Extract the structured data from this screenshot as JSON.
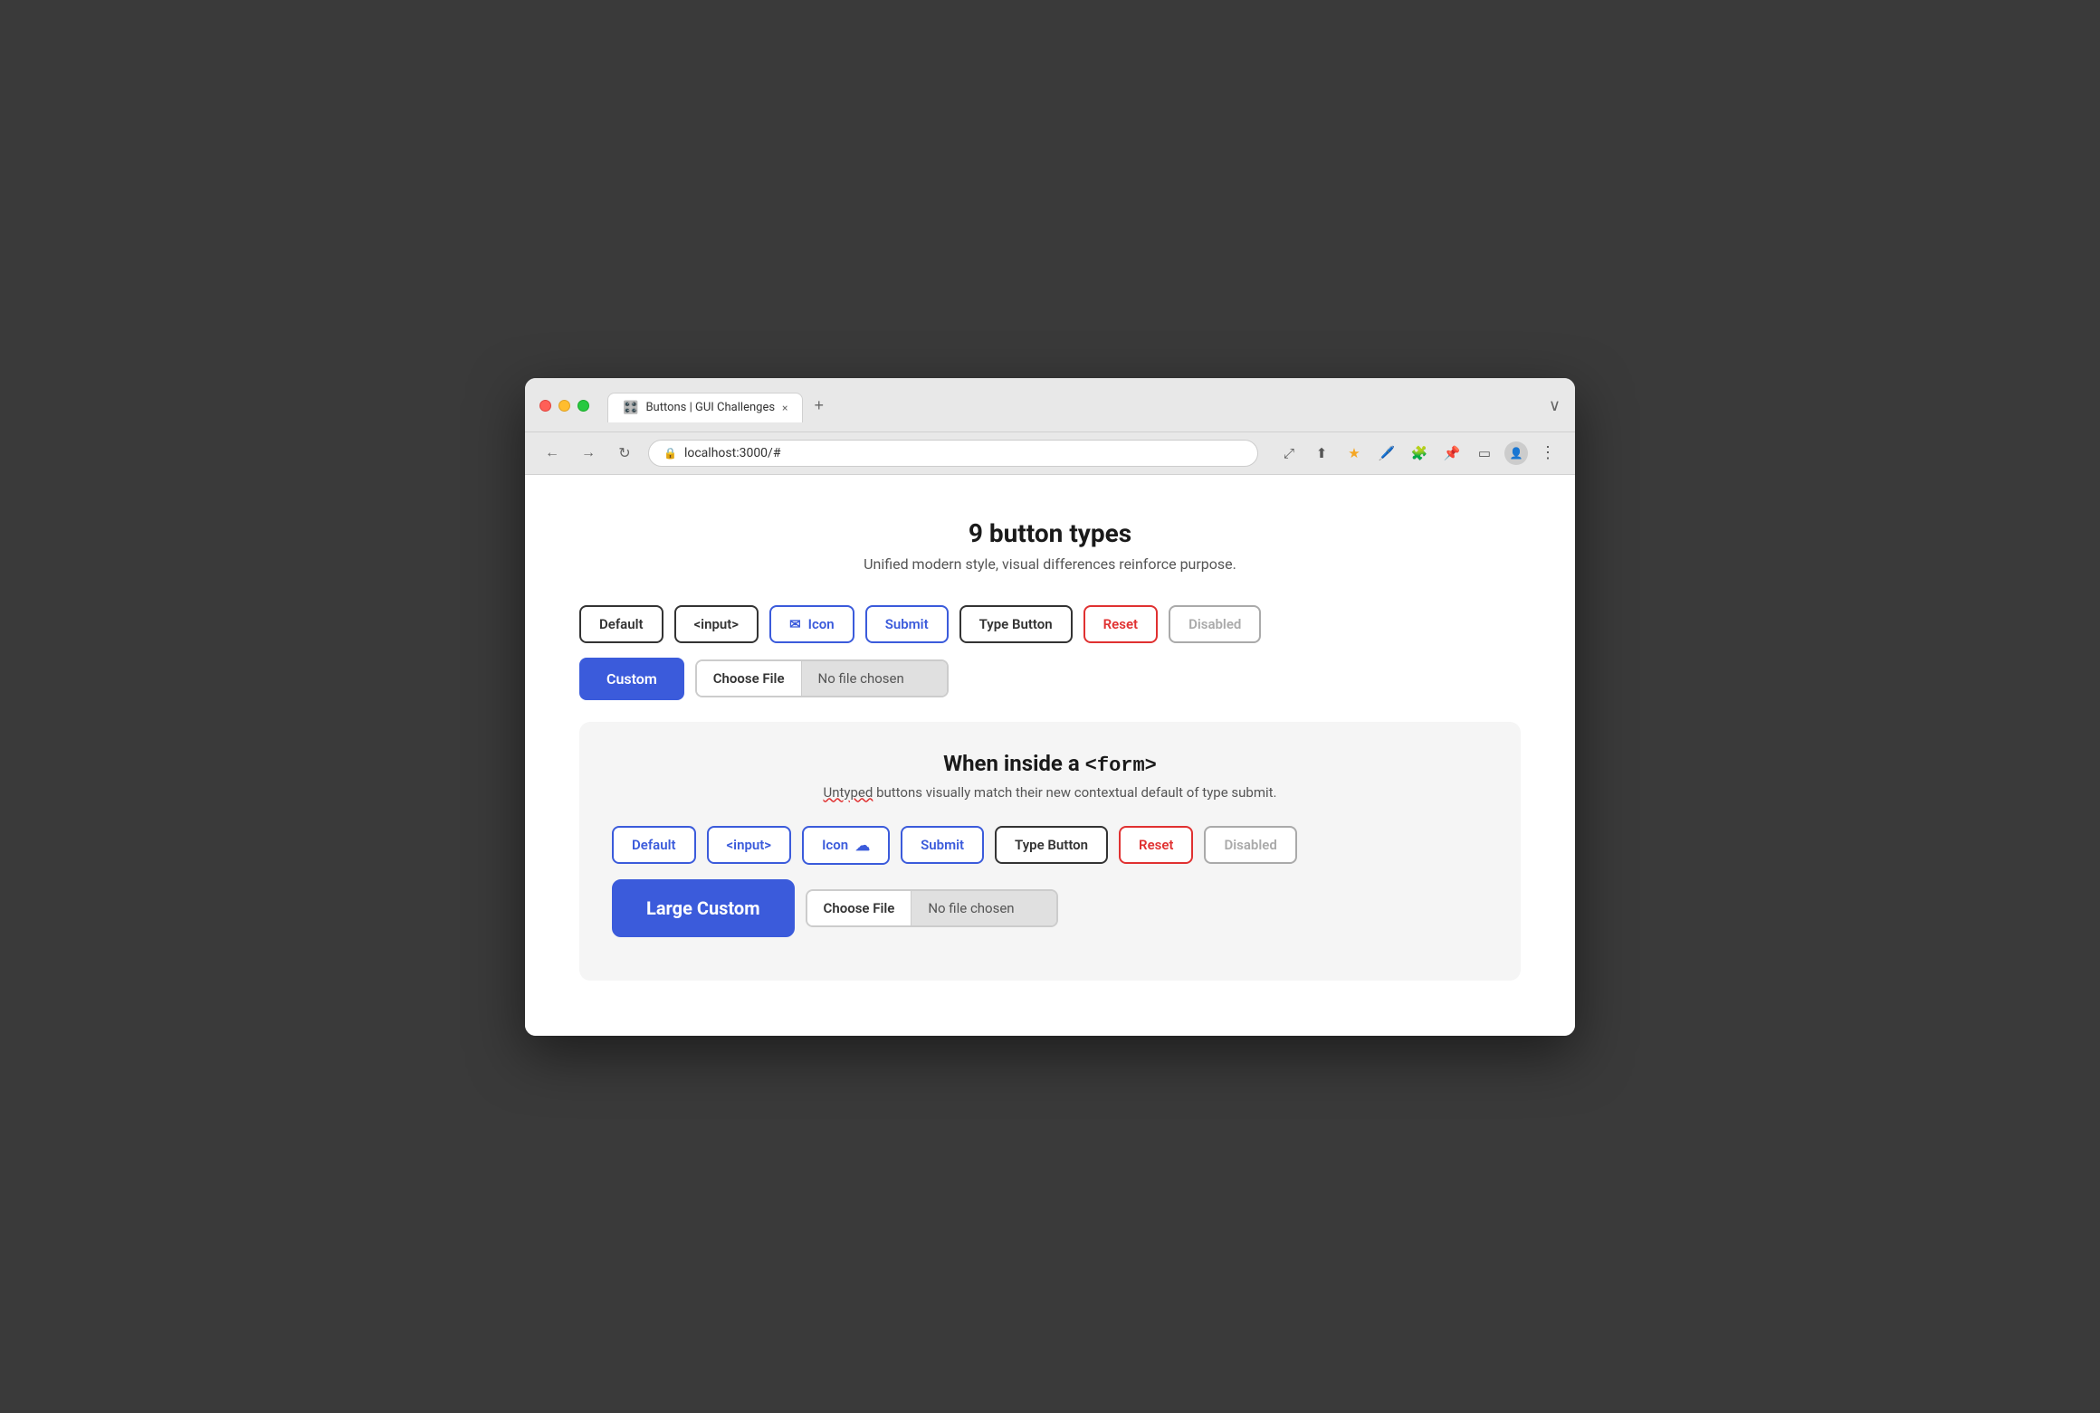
{
  "browser": {
    "tab_title": "Buttons | GUI Challenges",
    "tab_favicon": "🎛️",
    "url": "localhost:3000/#",
    "new_tab_label": "+",
    "close_tab_label": "×",
    "nav": {
      "back": "←",
      "forward": "→",
      "refresh": "↻"
    },
    "expand_icon": "⤢",
    "share_icon": "⬆",
    "star_icon": "★",
    "extension_icon": "🧩",
    "pin_icon": "📌",
    "sidebar_icon": "▭",
    "profile_icon": "👤",
    "more_icon": "⋮"
  },
  "page": {
    "title": "9 button types",
    "subtitle": "Unified modern style, visual differences reinforce purpose."
  },
  "row1": {
    "default_label": "Default",
    "input_label": "<input>",
    "icon_label": "Icon",
    "submit_label": "Submit",
    "type_button_label": "Type Button",
    "reset_label": "Reset",
    "disabled_label": "Disabled"
  },
  "row2": {
    "custom_label": "Custom",
    "choose_file_label": "Choose File",
    "no_file_label": "No file chosen"
  },
  "form_section": {
    "title_prefix": "When inside a ",
    "title_code": "<form>",
    "subtitle_untyped": "Untyped",
    "subtitle_rest": " buttons visually match their new contextual default of type submit."
  },
  "form_row1": {
    "default_label": "Default",
    "input_label": "<input>",
    "icon_label": "Icon",
    "icon_emoji": "☁",
    "submit_label": "Submit",
    "type_button_label": "Type Button",
    "reset_label": "Reset",
    "disabled_label": "Disabled"
  },
  "form_row2": {
    "large_custom_label": "Large Custom",
    "choose_file_label": "Choose File",
    "no_file_label": "No file chosen"
  }
}
